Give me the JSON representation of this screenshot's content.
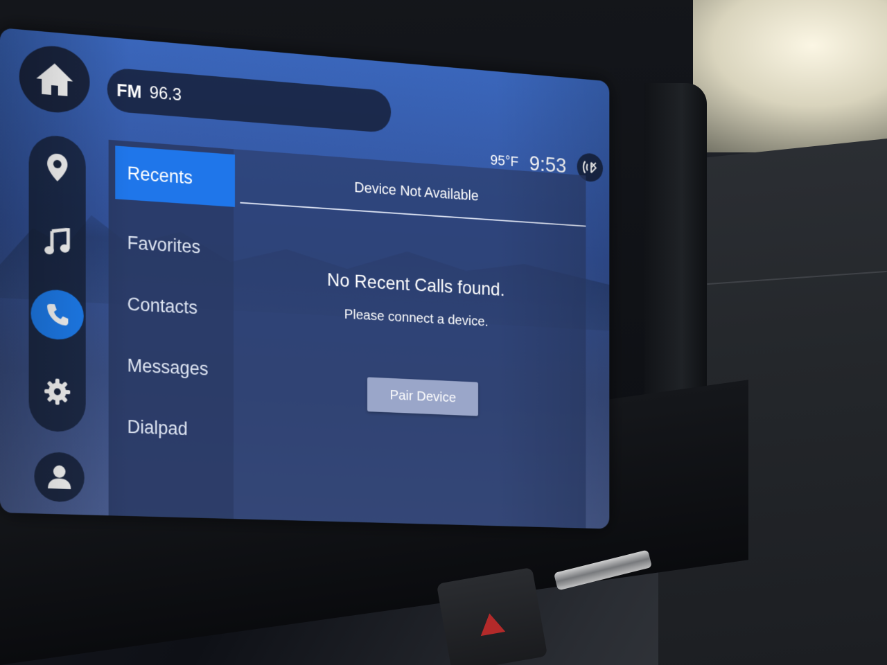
{
  "source": {
    "band": "FM",
    "frequency": "96.3"
  },
  "status": {
    "temperature": "95°F",
    "time": "9:53",
    "signal_icon": "wireless-signal-icon"
  },
  "rail": {
    "items": [
      {
        "icon": "home-icon",
        "active": false
      },
      {
        "icon": "map-pin-icon",
        "active": false
      },
      {
        "icon": "music-note-icon",
        "active": false
      },
      {
        "icon": "phone-icon",
        "active": true
      },
      {
        "icon": "gear-icon",
        "active": false
      },
      {
        "icon": "user-icon",
        "active": false
      }
    ]
  },
  "phone": {
    "menu": [
      {
        "label": "Recents",
        "selected": true
      },
      {
        "label": "Favorites",
        "selected": false
      },
      {
        "label": "Contacts",
        "selected": false
      },
      {
        "label": "Messages",
        "selected": false
      },
      {
        "label": "Dialpad",
        "selected": false
      }
    ],
    "header": "Device Not Available",
    "empty_title": "No Recent Calls found.",
    "empty_subtitle": "Please connect a device.",
    "pair_button": "Pair Device"
  },
  "colors": {
    "accent": "#1f76ea",
    "screen_bg": "#3a5a9e",
    "button": "#9aa6c9"
  }
}
